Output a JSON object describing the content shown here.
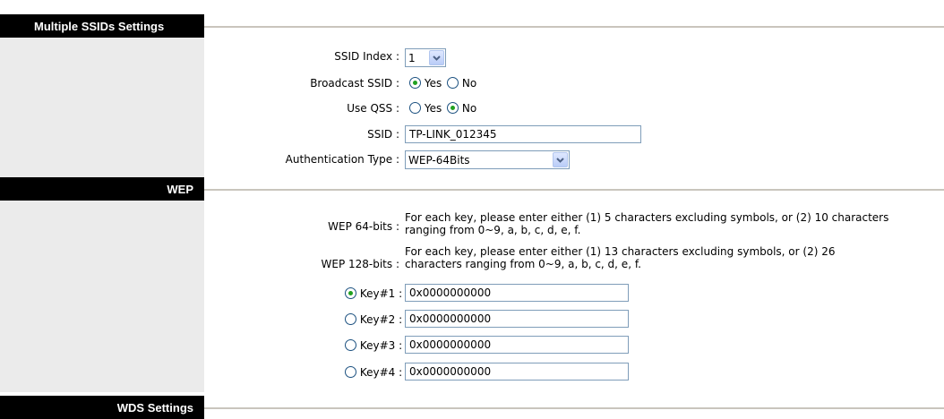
{
  "sections": {
    "multiple_ssids": "Multiple SSIDs Settings",
    "wep": "WEP",
    "wds": "WDS Settings"
  },
  "form": {
    "ssid_index_label": "SSID Index :",
    "ssid_index_value": "1",
    "broadcast_ssid_label": "Broadcast SSID :",
    "use_qss_label": "Use QSS :",
    "yes_label": "Yes",
    "no_label": "No",
    "broadcast_ssid_selected": "Yes",
    "use_qss_selected": "No",
    "ssid_label": "SSID :",
    "ssid_value": "TP-LINK_012345",
    "auth_type_label": "Authentication Type :",
    "auth_type_value": "WEP-64Bits"
  },
  "wep": {
    "wep64_label": "WEP 64-bits :",
    "wep64_line1": "For each key, please enter either (1) 5 characters excluding symbols, or (2) 10 characters",
    "wep64_line2": "ranging from 0~9, a, b, c, d, e, f.",
    "wep128_label": "WEP 128-bits :",
    "wep128_line1": "For each key, please enter either (1) 13 characters excluding symbols, or (2) 26",
    "wep128_line2": "characters ranging from 0~9, a, b, c, d, e, f.",
    "keys": [
      {
        "label": "Key#1 :",
        "value": "0x0000000000",
        "selected": true
      },
      {
        "label": "Key#2 :",
        "value": "0x0000000000",
        "selected": false
      },
      {
        "label": "Key#3 :",
        "value": "0x0000000000",
        "selected": false
      },
      {
        "label": "Key#4 :",
        "value": "0x0000000000",
        "selected": false
      }
    ]
  },
  "colors": {
    "header_bg": "#000000",
    "left_col_bg": "#ebebeb",
    "radio_checked": "#21a121",
    "input_border": "#7f9db9"
  }
}
